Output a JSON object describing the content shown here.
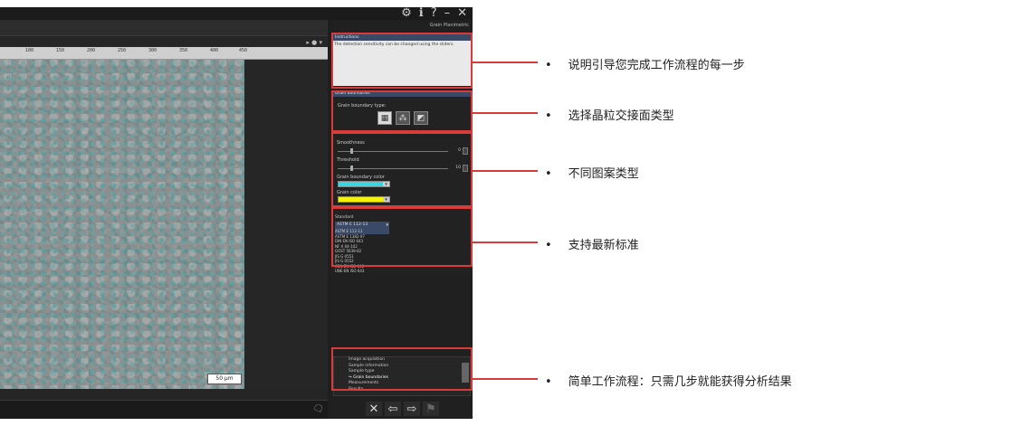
{
  "window": {
    "controls": [
      "⚙",
      "ℹ",
      "?",
      "–",
      "✕"
    ]
  },
  "viewer": {
    "ruler_ticks": [
      "100",
      "150",
      "200",
      "250",
      "300",
      "350",
      "400",
      "450",
      "500",
      "550",
      "600"
    ],
    "scale_label": "50 µm"
  },
  "panel": {
    "header": "Grain Planimetric",
    "instructions": {
      "title": "Instructions",
      "text": "The detection sensitivity can be changed using the sliders."
    },
    "grain_boundaries": {
      "title": "Grain boundaries",
      "label": "Grain boundary type:"
    },
    "smoothness": {
      "label": "Smoothness",
      "value": "0"
    },
    "threshold": {
      "label": "Threshold",
      "value": "10"
    },
    "boundary_color": {
      "label": "Grain boundary color",
      "color": "#39d4e0"
    },
    "grain_color": {
      "label": "Grain color",
      "color": "#f2f20a"
    },
    "standard": {
      "label": "Standard",
      "selected": "ASTM E 112-13",
      "options": [
        "ASTM E 112-13",
        "ASTM E 1382-97",
        "DIN EN ISO 643",
        "NF A 04-102",
        "GOST 5639-82",
        "JIS G 0551",
        "JIS G 0552",
        "CSN EN ISO 643",
        "UNE-EN ISO 643"
      ]
    },
    "workflow_steps": [
      "Image acquisition",
      "Sample information",
      "Sample type",
      "Grain boundaries",
      "Measurements",
      "Results"
    ],
    "current_step_index": 3
  },
  "annotations": [
    "说明引导您完成工作流程的每一步",
    "选择晶粒交接面类型",
    "不同图案类型",
    "支持最新标准",
    "简单工作流程：只需几步就能获得分析结果"
  ],
  "colors": {
    "highlight": "#d93a3a",
    "section_header": "#3a4a66"
  }
}
